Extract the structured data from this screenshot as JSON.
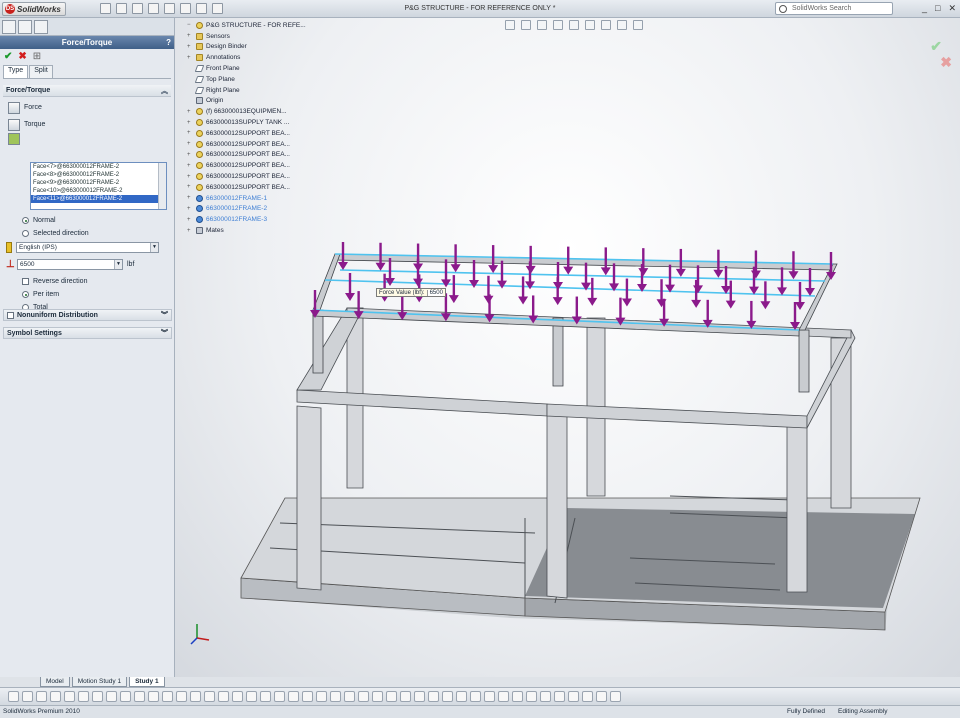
{
  "window": {
    "app_name": "SolidWorks",
    "title": "P&G STRUCTURE - FOR REFERENCE ONLY *",
    "search_placeholder": "SolidWorks Search",
    "controls": [
      "_",
      "□",
      "✕"
    ]
  },
  "property_manager": {
    "title": "Force/Torque",
    "help": "?",
    "subtabs": [
      "Type",
      "Split"
    ],
    "group_force_torque": "Force/Torque",
    "force_label": "Force",
    "torque_label": "Torque",
    "faces": [
      "Face<7>@663000012FRAME-2",
      "Face<8>@663000012FRAME-2",
      "Face<9>@663000012FRAME-2",
      "Face<10>@663000012FRAME-2",
      "Face<11>@663000012FRAME-2"
    ],
    "selected_face_index": 4,
    "direction_normal": "Normal",
    "direction_selected": "Selected direction",
    "units": "English (IPS)",
    "force_value": "6500",
    "force_unit": "lbf",
    "reverse_direction": "Reverse direction",
    "per_item": "Per item",
    "total": "Total",
    "nonuniform": "Nonuniform Distribution",
    "symbol_settings": "Symbol Settings"
  },
  "tree": {
    "root": "P&G STRUCTURE - FOR REFE...",
    "items": [
      {
        "label": "Sensors",
        "icon": "folder-icon"
      },
      {
        "label": "Design Binder",
        "icon": "folder-icon"
      },
      {
        "label": "Annotations",
        "icon": "annotation-icon"
      },
      {
        "label": "Front Plane",
        "icon": "plane-icon"
      },
      {
        "label": "Top Plane",
        "icon": "plane-icon"
      },
      {
        "label": "Right Plane",
        "icon": "plane-icon"
      },
      {
        "label": "Origin",
        "icon": "origin-icon"
      },
      {
        "label": "(f) 663000013EQUIPMEN...",
        "icon": "part-icon"
      },
      {
        "label": "663000013SUPPLY TANK ...",
        "icon": "part-icon"
      },
      {
        "label": "663000012SUPPORT BEA...",
        "icon": "part-icon"
      },
      {
        "label": "663000012SUPPORT BEA...",
        "icon": "part-icon"
      },
      {
        "label": "663000012SUPPORT BEA...",
        "icon": "part-icon"
      },
      {
        "label": "663000012SUPPORT BEA...",
        "icon": "part-icon"
      },
      {
        "label": "663000012SUPPORT BEA...",
        "icon": "part-icon"
      },
      {
        "label": "663000012SUPPORT BEA...",
        "icon": "part-icon"
      },
      {
        "label": "663000012FRAME-1",
        "icon": "blue-part-icon"
      },
      {
        "label": "663000012FRAME-2",
        "icon": "blue-part-icon"
      },
      {
        "label": "663000012FRAME-3",
        "icon": "blue-part-icon"
      },
      {
        "label": "Mates",
        "icon": "mates-icon"
      }
    ]
  },
  "viewport": {
    "force_callout_label": "Force Value (lbf):",
    "force_callout_value": "6500",
    "arrow_color": "#8b1a8b",
    "highlight_color": "#4fc3ef"
  },
  "bottom_tabs": [
    "Model",
    "Motion Study 1",
    "Study 1"
  ],
  "status": {
    "app_version": "SolidWorks Premium 2010",
    "definition": "Fully Defined",
    "mode": "Editing Assembly"
  }
}
